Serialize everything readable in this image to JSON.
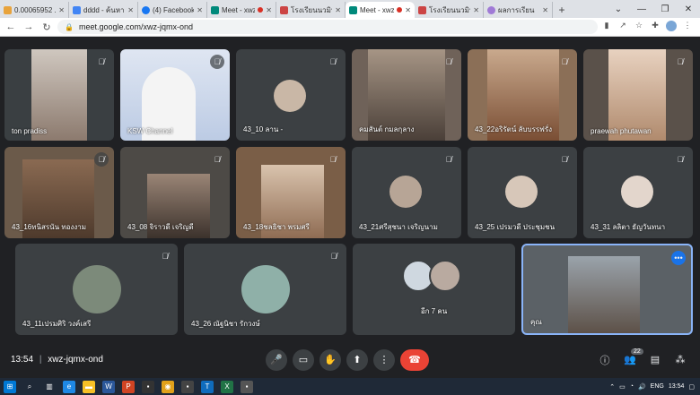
{
  "tabs": [
    {
      "title": "0.00065952 ...",
      "fav": "#e8a33c"
    },
    {
      "title": "dddd - ค้นหาด้วย",
      "fav": "#4285f4"
    },
    {
      "title": "(4) Facebook",
      "fav": "#1877f2"
    },
    {
      "title": "Meet - xwz-",
      "fav": "#00897b",
      "rec": true
    },
    {
      "title": "โรงเรียนนวมินฯ",
      "fav": "#c44"
    },
    {
      "title": "Meet - xwz",
      "fav": "#00897b",
      "rec": true,
      "active": true
    },
    {
      "title": "โรงเรียนนวมินฯ",
      "fav": "#c44"
    },
    {
      "title": "ผลการเรียน",
      "fav": "#a07ad6"
    }
  ],
  "address": {
    "url": "meet.google.com/xwz-jqmx-ond"
  },
  "participants": [
    {
      "name": "ton pradiss",
      "muted": true
    },
    {
      "name": "KSW Channel",
      "muted": true
    },
    {
      "name": "43_10 ลาน -",
      "muted": true
    },
    {
      "name": "คมสันต์ กมลกุลาง",
      "muted": true
    },
    {
      "name": "43_22อริรัตน์ ลับบรรฟรั่ง",
      "muted": true
    },
    {
      "name": "praewah phutawan",
      "muted": true
    },
    {
      "name": "43_16ทนิสรนัน ทองงาม",
      "muted": true
    },
    {
      "name": "43_08 จิราวดี เจริญดี",
      "muted": true
    },
    {
      "name": "43_18ชลธิชา พรมศรี",
      "muted": true
    },
    {
      "name": "43_21ศรีสุชนา เจริญนาม",
      "muted": true
    },
    {
      "name": "43_25 เปรมวดี ประชุมชน",
      "muted": true
    },
    {
      "name": "43_31 ลลิตา ธัญวันทนา",
      "muted": true
    },
    {
      "name": "43_11เปรมศิริ วงค์เสรี",
      "muted": true
    },
    {
      "name": "43_26 ณัฐนิชา รักวงษ์",
      "muted": true
    },
    {
      "name": "อีก 7 คน",
      "muted": false
    },
    {
      "name": "คุณ",
      "muted": false
    }
  ],
  "meeting": {
    "time": "13:54",
    "separator": "|",
    "code": "xwz-jqmx-ond",
    "participant_count": "22"
  },
  "taskbar": {
    "time": "13:54",
    "lang": "ENG"
  }
}
